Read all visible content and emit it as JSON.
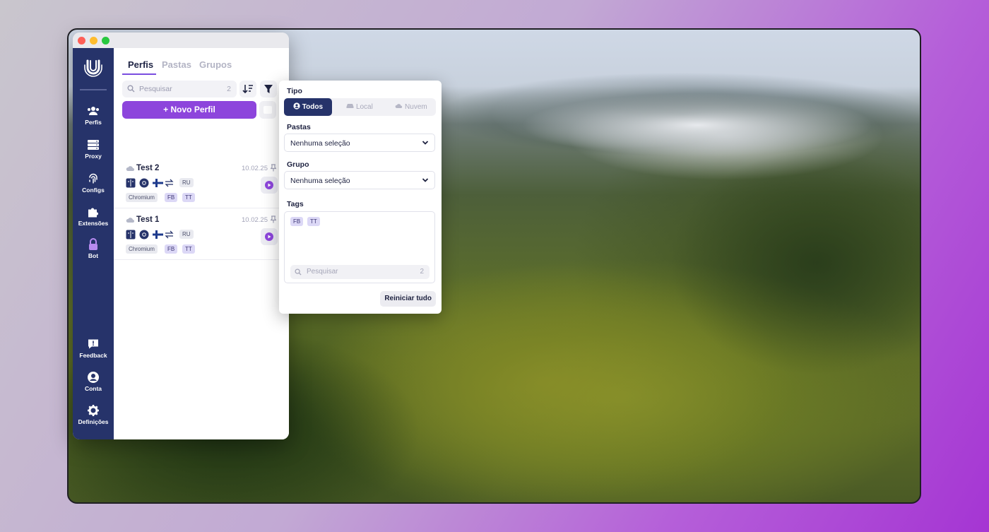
{
  "sidebar": {
    "items": [
      {
        "label": "Perfis",
        "icon": "users-icon"
      },
      {
        "label": "Proxy",
        "icon": "server-icon"
      },
      {
        "label": "Configs",
        "icon": "fingerprint-icon"
      },
      {
        "label": "Extensões",
        "icon": "puzzle-icon"
      },
      {
        "label": "Bot",
        "icon": "lock-icon"
      }
    ],
    "bottom_items": [
      {
        "label": "Feedback",
        "icon": "feedback-icon"
      },
      {
        "label": "Conta",
        "icon": "account-icon"
      },
      {
        "label": "Definições",
        "icon": "gear-icon"
      }
    ]
  },
  "tabs": [
    {
      "label": "Perfis",
      "active": true
    },
    {
      "label": "Pastas",
      "active": false
    },
    {
      "label": "Grupos",
      "active": false
    }
  ],
  "search": {
    "placeholder": "Pesquisar",
    "count": "2"
  },
  "new_profile_label": "+ Novo Perfil",
  "profiles": [
    {
      "name": "Test 2",
      "date": "10.02.25",
      "country": "RU",
      "tags": [
        "Chromium",
        "FB",
        "TT"
      ]
    },
    {
      "name": "Test 1",
      "date": "10.02.25",
      "country": "RU",
      "tags": [
        "Chromium",
        "FB",
        "TT"
      ]
    }
  ],
  "filter": {
    "tipo_label": "Tipo",
    "tipo_options": [
      {
        "label": "Todos",
        "active": true
      },
      {
        "label": "Local",
        "active": false
      },
      {
        "label": "Nuvem",
        "active": false
      }
    ],
    "pastas_label": "Pastas",
    "pastas_value": "Nenhuma seleção",
    "grupo_label": "Grupo",
    "grupo_value": "Nenhuma seleção",
    "tags_label": "Tags",
    "tags": [
      "FB",
      "TT"
    ],
    "tag_search_placeholder": "Pesquisar",
    "tag_search_count": "2",
    "reset_label": "Reiniciar tudo"
  },
  "colors": {
    "sidebar": "#26336a",
    "accent": "#8d45dc",
    "tag_bg": "#dcd8f6"
  }
}
